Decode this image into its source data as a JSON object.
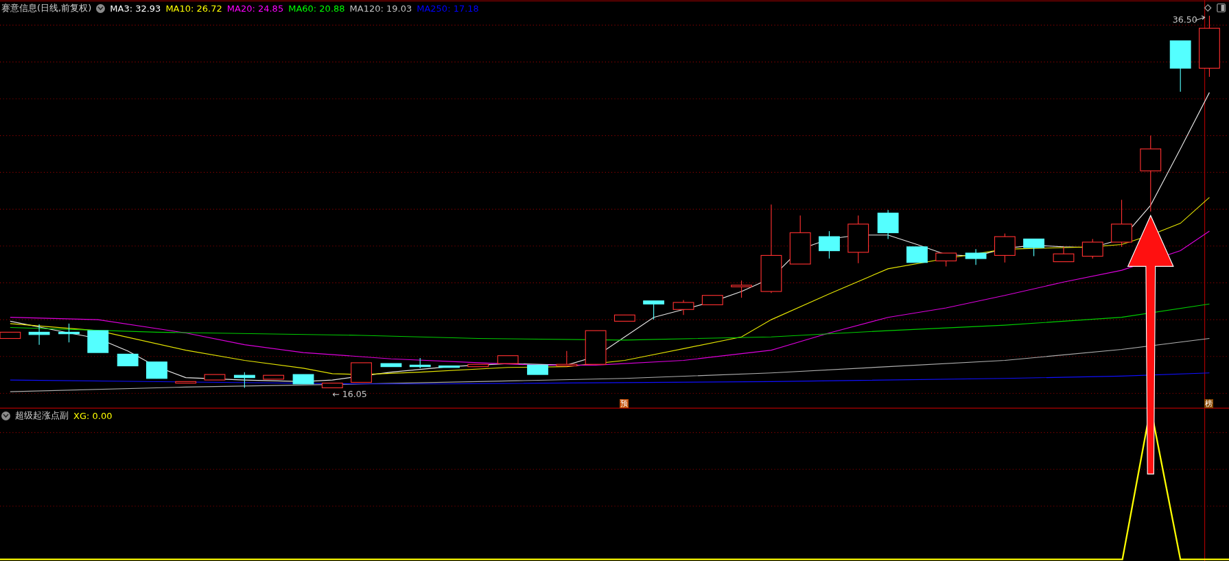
{
  "main_chart": {
    "title": "赛意信息(日线,前复权)",
    "ma_indicators": [
      {
        "text": "MA3: 32.93",
        "color": "#ffffff"
      },
      {
        "text": "MA10: 26.72",
        "color": "#ffff00"
      },
      {
        "text": "MA20: 24.85",
        "color": "#ff00ff"
      },
      {
        "text": "MA60: 20.88",
        "color": "#00ff00"
      },
      {
        "text": "MA120: 19.03",
        "color": "#c0c0c0"
      },
      {
        "text": "MA250: 17.18",
        "color": "#0000ff"
      }
    ],
    "high_label": "36.50",
    "low_label": "← 16.05",
    "signal_badges": [
      {
        "text": "预",
        "color": "#c04a00"
      },
      {
        "text": "榜",
        "color": "#8a4a00"
      }
    ]
  },
  "sub_chart": {
    "title": "超级起涨点副",
    "readings": [
      {
        "text": "XG: 0.00",
        "color": "#ffff00"
      }
    ]
  }
}
